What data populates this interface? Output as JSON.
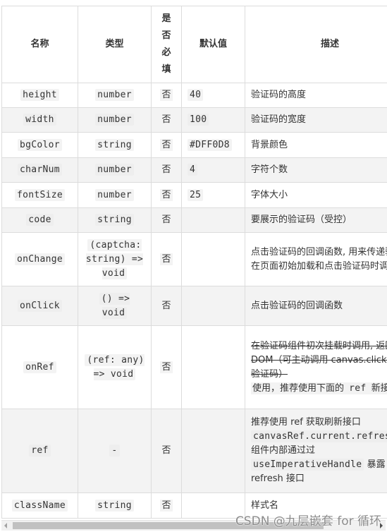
{
  "table": {
    "headers": {
      "name": "名称",
      "type": "类型",
      "required": "是否必填",
      "default": "默认值",
      "description": "描述"
    },
    "rows": [
      {
        "name": "height",
        "type": "number",
        "required": "否",
        "default": "40",
        "description": "验证码的高度"
      },
      {
        "name": "width",
        "type": "number",
        "required": "否",
        "default": "100",
        "description": "验证码的宽度"
      },
      {
        "name": "bgColor",
        "type": "string",
        "required": "否",
        "default": "#DFF0D8",
        "description": "背景颜色"
      },
      {
        "name": "charNum",
        "type": "number",
        "required": "否",
        "default": "4",
        "description": "字符个数"
      },
      {
        "name": "fontSize",
        "type": "number",
        "required": "否",
        "default": "25",
        "description": "字体大小"
      },
      {
        "name": "code",
        "type": "string",
        "required": "否",
        "default": "",
        "description": "要展示的验证码（受控）"
      },
      {
        "name": "onChange",
        "type": "(captcha: string) => void",
        "required": "否",
        "default": "",
        "description": "点击验证码的回调函数, 用来传递验证码（会在页面初始加载和点击验证码时调用）"
      },
      {
        "name": "onClick",
        "type": "() => void",
        "required": "否",
        "default": "",
        "description": "点击验证码的回调函数"
      },
      {
        "name": "onRef",
        "type": "(ref: any) => void",
        "required": "否",
        "default": "",
        "description_strike": "在验证码组件初次挂载时调用, 返回 canvas DOM（可主动调用 canvas.click() 来刷新验证码）",
        "description_note_prefix": "使用，推荐使用下面的",
        "description_note_code": "ref",
        "description_note_suffix": "新接口"
      },
      {
        "name": "ref",
        "type": "-",
        "required": "否",
        "default": "",
        "description_line1": "推荐使用 ref 获取刷新接口",
        "description_code1": "canvasRef.current.refresh()",
        "description_line2": "组件内部通过过",
        "description_code2": "useImperativeHandle",
        "description_line2b": "暴露",
        "description_line3": "refresh 接口"
      },
      {
        "name": "className",
        "type": "string",
        "required": "否",
        "default": "",
        "description": "样式名"
      }
    ]
  },
  "scrollbar": {
    "orientation": "horizontal",
    "position_fraction": 0.0,
    "visible_fraction": 0.86
  },
  "watermark": "CSDN @九层嵌套 for 循环"
}
